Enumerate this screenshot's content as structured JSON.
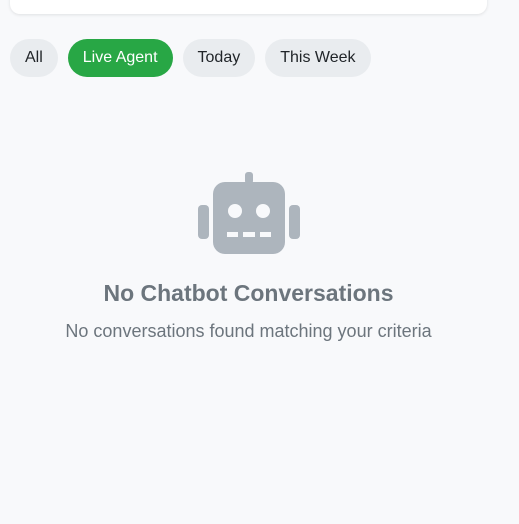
{
  "filters": [
    {
      "label": "All",
      "active": false
    },
    {
      "label": "Live Agent",
      "active": true
    },
    {
      "label": "Today",
      "active": false
    },
    {
      "label": "This Week",
      "active": false
    }
  ],
  "empty_state": {
    "icon": "robot-icon",
    "title": "No Chatbot Conversations",
    "subtitle": "No conversations found matching your criteria"
  },
  "colors": {
    "accent": "#28a745",
    "chip_bg": "#e9ecef",
    "muted_text": "#6c757d",
    "icon_gray": "#adb5bd",
    "page_bg": "#f8f9fb"
  }
}
